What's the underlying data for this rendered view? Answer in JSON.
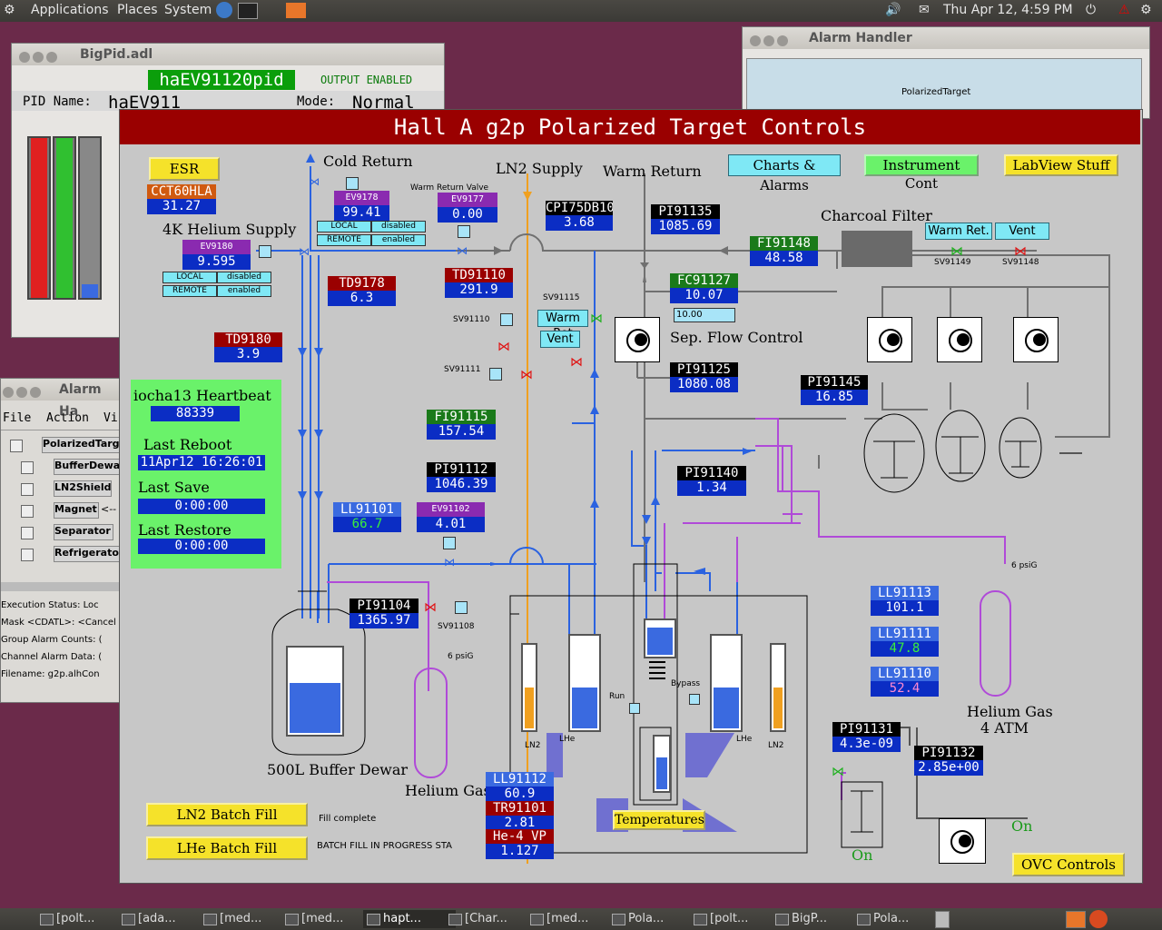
{
  "top_panel": {
    "applications": "Applications",
    "places": "Places",
    "system": "System",
    "datetime": "Thu Apr 12,  4:59 PM"
  },
  "taskbar": [
    "[polt...",
    "[ada...",
    "[med...",
    "[med...",
    "hapt...",
    "[Char...",
    "[med...",
    "Pola...",
    "[polt...",
    "BigP...",
    "Pola..."
  ],
  "bigpid": {
    "title": "BigPid.adl",
    "pv": "haEV91120pid",
    "output": "OUTPUT ENABLED",
    "pid_name_label": "PID Name:",
    "pid_name": "haEV911",
    "mode_label": "Mode:",
    "mode": "Normal"
  },
  "alarm_handler": {
    "title": "Alarm Handler",
    "group": "PolarizedTarget"
  },
  "alarm_small": {
    "title": "Alarm Ha",
    "menu": [
      "File",
      "Action",
      "Vi"
    ],
    "tree": [
      "PolarizedTarg",
      "BufferDewa",
      "LN2Shield",
      "Magnet",
      "Separator",
      "Refrigerator"
    ],
    "arrow": "<--",
    "status": [
      "Execution Status:  Loc",
      "Mask <CDATL>:  <Cancel",
      "Group Alarm Counts:  (",
      "Channel Alarm Data:  (",
      "Filename:   g2p.alhCon"
    ]
  },
  "main": {
    "title": "Hall A g2p Polarized Target Controls",
    "buttons": {
      "esr": "ESR",
      "charts": "Charts & Alarms",
      "instrument": "Instrument Cont",
      "labview": "LabView Stuff",
      "ln2_batch": "LN2 Batch Fill",
      "lhe_batch": "LHe Batch Fill",
      "temperatures": "Temperatures",
      "ovc": "OVC Controls",
      "warm_ret": "Warm Ret.",
      "vent": "Vent",
      "warm_ret2": "Warm Ret",
      "vent2": "Vent"
    },
    "labels": {
      "cold_return": "Cold Return",
      "ln2_supply": "LN2 Supply",
      "warm_return": "Warm Return",
      "warm_return_valve": "Warm Return Valve",
      "he4k_supply": "4K Helium Supply",
      "charcoal": "Charcoal Filter",
      "sep_flow": "Sep. Flow Control",
      "buffer_dewar": "500L Buffer Dewar",
      "helium_gas": "Helium Gas",
      "helium_gas_4atm_1": "Helium Gas",
      "helium_gas_4atm_2": "4 ATM",
      "fill_complete": "Fill complete",
      "batch_status": "BATCH FILL IN PROGRESS STA",
      "on1": "On",
      "on2": "On",
      "psig1": "6 psiG",
      "psig2": "6 psiG",
      "run": "Run",
      "bypass": "Bypass",
      "ln2_l": "LN2",
      "lhe_l": "LHe",
      "lhe_r": "LHe",
      "ln2_r": "LN2"
    },
    "valves": {
      "sv91149": "SV91149",
      "sv91148": "SV91148",
      "sv91115": "SV91115",
      "sv91110": "SV91110",
      "sv91111": "SV91111",
      "sv91108": "SV91108"
    },
    "heartbeat": {
      "title": "iocha13 Heartbeat",
      "value": "88339",
      "reboot_label": "Last Reboot",
      "reboot": "11Apr12 16:26:01",
      "save_label": "Last Save",
      "save": "0:00:00",
      "restore_label": "Last Restore",
      "restore": "0:00:00"
    },
    "ev9180": {
      "name": "EV9180",
      "value": "9.595",
      "local": "LOCAL",
      "remote": "REMOTE",
      "s1": "disabled",
      "s2": "enabled"
    },
    "ev9178": {
      "name": "EV9178",
      "value": "99.41",
      "local": "LOCAL",
      "remote": "REMOTE",
      "s1": "disabled",
      "s2": "enabled"
    },
    "ev9177": {
      "name": "EV9177",
      "value": "0.00"
    },
    "ev91102": {
      "name": "EV91102",
      "value": "4.01"
    },
    "cct60hla": {
      "name": "CCT60HLA",
      "value": "31.27"
    },
    "td9178": {
      "name": "TD9178",
      "value": "6.3"
    },
    "td9180": {
      "name": "TD9180",
      "value": "3.9"
    },
    "td91110": {
      "name": "TD91110",
      "value": "291.9"
    },
    "cpi75db10": {
      "name": "CPI75DB10",
      "value": "3.68"
    },
    "pi91135": {
      "name": "PI91135",
      "value": "1085.69"
    },
    "fi91148": {
      "name": "FI91148",
      "value": "48.58"
    },
    "fc91127": {
      "name": "FC91127",
      "value": "10.07",
      "setpoint": "10.00"
    },
    "pi91125": {
      "name": "PI91125",
      "value": "1080.08"
    },
    "pi91145": {
      "name": "PI91145",
      "value": "16.85"
    },
    "fi91115": {
      "name": "FI91115",
      "value": "157.54"
    },
    "pi91112": {
      "name": "PI91112",
      "value": "1046.39"
    },
    "pi91140": {
      "name": "PI91140",
      "value": "1.34"
    },
    "ll91101": {
      "name": "LL91101",
      "value": "66.7"
    },
    "pi91104": {
      "name": "PI91104",
      "value": "1365.97"
    },
    "ll91113": {
      "name": "LL91113",
      "value": "101.1"
    },
    "ll91111": {
      "name": "LL91111",
      "value": "47.8"
    },
    "ll91110": {
      "name": "LL91110",
      "value": "52.4"
    },
    "pi91131": {
      "name": "PI91131",
      "value": "4.3e-09"
    },
    "pi91132": {
      "name": "PI91132",
      "value": "2.85e+00"
    },
    "ll91112": {
      "name": "LL91112",
      "value": "60.9"
    },
    "tr91101": {
      "name": "TR91101",
      "value": "2.81"
    },
    "he4vp": {
      "name": "He-4 VP",
      "value": "1.127"
    }
  },
  "colors": {
    "banner": "#9a0000",
    "value_bg": "#0b2dc4",
    "pipe_blue": "#2a62e0",
    "pipe_purple": "#b04ad8",
    "pipe_orange": "#f0a020",
    "pipe_gray": "#707070"
  }
}
